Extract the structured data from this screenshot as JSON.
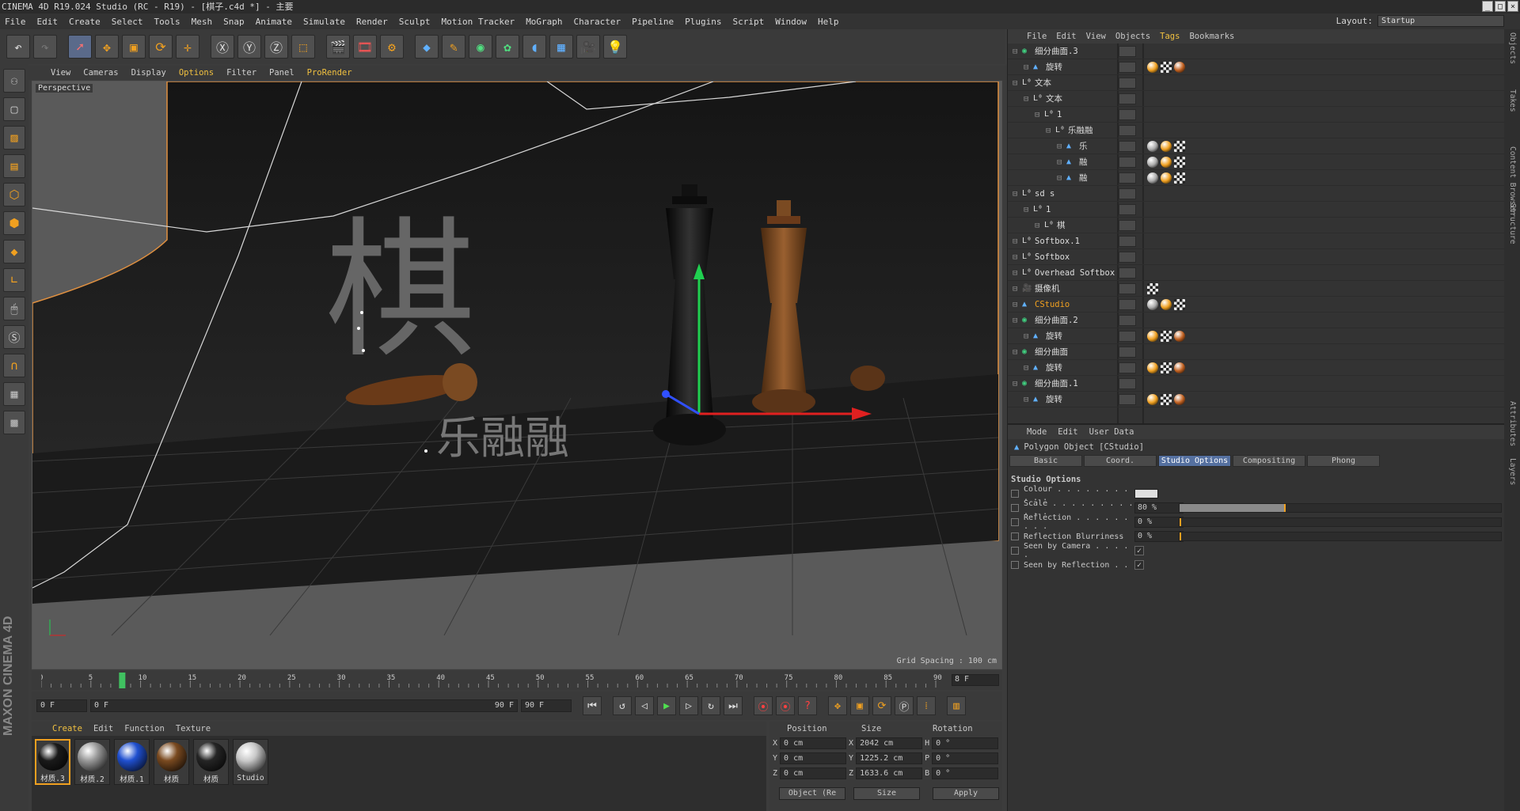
{
  "window": {
    "title": "CINEMA 4D R19.024 Studio (RC - R19) - [棋子.c4d *] - 主要"
  },
  "menubar": {
    "items": [
      "File",
      "Edit",
      "Create",
      "Select",
      "Tools",
      "Mesh",
      "Snap",
      "Animate",
      "Simulate",
      "Render",
      "Sculpt",
      "Motion Tracker",
      "MoGraph",
      "Character",
      "Pipeline",
      "Plugins",
      "Script",
      "Window",
      "Help"
    ],
    "layout_label": "Layout:",
    "layout_value": "Startup"
  },
  "viewport": {
    "menu": [
      "View",
      "Cameras",
      "Display",
      "Options",
      "Filter",
      "Panel",
      "ProRender"
    ],
    "label": "Perspective",
    "grid_spacing": "Grid Spacing : 100 cm",
    "text_big": "棋",
    "text_small": "乐融融"
  },
  "timeline": {
    "ticks": [
      "0",
      "5",
      "10",
      "15",
      "20",
      "25",
      "30",
      "35",
      "40",
      "45",
      "50",
      "55",
      "60",
      "65",
      "70",
      "75",
      "80",
      "85",
      "90"
    ],
    "current_tick": "8",
    "current_frame": "8 F",
    "current_position": 0.089
  },
  "transport": {
    "start": "0 F",
    "range_start": "0 F",
    "range_end": "90 F",
    "end": "90 F"
  },
  "materials": {
    "menu": [
      "Create",
      "Edit",
      "Function",
      "Texture"
    ],
    "items": [
      {
        "name": "材质.3",
        "color": "#1a1a1a"
      },
      {
        "name": "材质.2",
        "color": "#9a9a9a"
      },
      {
        "name": "材质.1",
        "color": "#2050d0"
      },
      {
        "name": "材质",
        "color": "#7a4a20"
      },
      {
        "name": "材质",
        "color": "#252525"
      },
      {
        "name": "Studio",
        "color": "#c8c8c8"
      }
    ]
  },
  "coordinates": {
    "headers": [
      "Position",
      "Size",
      "Rotation"
    ],
    "rows": [
      {
        "axis": "X",
        "pos": "0 cm",
        "size_axis": "X",
        "size": "2042 cm",
        "rot_axis": "H",
        "rot": "0 °"
      },
      {
        "axis": "Y",
        "pos": "0 cm",
        "size_axis": "Y",
        "size": "1225.2 cm",
        "rot_axis": "P",
        "rot": "0 °"
      },
      {
        "axis": "Z",
        "pos": "0 cm",
        "size_axis": "Z",
        "size": "1633.6 cm",
        "rot_axis": "B",
        "rot": "0 °"
      }
    ],
    "mode": "Object (Re",
    "size_mode": "Size",
    "apply": "Apply"
  },
  "objects": {
    "menu": [
      "File",
      "Edit",
      "View",
      "Objects",
      "Tags",
      "Bookmarks"
    ],
    "rows": [
      {
        "name": "细分曲面.3",
        "indent": 0,
        "icon": "subdiv"
      },
      {
        "name": "旋转",
        "indent": 1,
        "icon": "lathe"
      },
      {
        "name": "文本",
        "indent": 0,
        "icon": "null"
      },
      {
        "name": "文本",
        "indent": 1,
        "icon": "null"
      },
      {
        "name": "1",
        "indent": 2,
        "icon": "null"
      },
      {
        "name": "乐融融",
        "indent": 3,
        "icon": "null"
      },
      {
        "name": "乐",
        "indent": 4,
        "icon": "poly"
      },
      {
        "name": "融",
        "indent": 4,
        "icon": "poly"
      },
      {
        "name": "融",
        "indent": 4,
        "icon": "poly"
      },
      {
        "name": "sd s",
        "indent": 0,
        "icon": "null"
      },
      {
        "name": "1",
        "indent": 1,
        "icon": "null"
      },
      {
        "name": "棋",
        "indent": 2,
        "icon": "null"
      },
      {
        "name": "Softbox.1",
        "indent": 0,
        "icon": "null"
      },
      {
        "name": "Softbox",
        "indent": 0,
        "icon": "null"
      },
      {
        "name": "Overhead Softbox",
        "indent": 0,
        "icon": "null"
      },
      {
        "name": "摄像机",
        "indent": 0,
        "icon": "camera"
      },
      {
        "name": "CStudio",
        "indent": 0,
        "icon": "poly",
        "selected": true
      },
      {
        "name": "细分曲面.2",
        "indent": 0,
        "icon": "subdiv"
      },
      {
        "name": "旋转",
        "indent": 1,
        "icon": "lathe"
      },
      {
        "name": "细分曲面",
        "indent": 0,
        "icon": "subdiv"
      },
      {
        "name": "旋转",
        "indent": 1,
        "icon": "lathe"
      },
      {
        "name": "细分曲面.1",
        "indent": 0,
        "icon": "subdiv"
      },
      {
        "name": "旋转",
        "indent": 1,
        "icon": "lathe"
      }
    ]
  },
  "attributes": {
    "menu": [
      "Mode",
      "Edit",
      "User Data"
    ],
    "title": "Polygon Object [CStudio]",
    "tabs": [
      "Basic",
      "Coord.",
      "Studio Options",
      "Compositing",
      "Phong"
    ],
    "active_tab": "Studio Options",
    "section": "Studio Options",
    "rows": [
      {
        "label": "Colour . . . . . . . . . . .",
        "type": "color",
        "value": ""
      },
      {
        "label": "Scale . . . . . . . . . . . .",
        "type": "slider",
        "value": "80 %",
        "fill": 0.33
      },
      {
        "label": "Reflection . . . . . . . . .",
        "type": "slider",
        "value": "0 %",
        "fill": 0
      },
      {
        "label": "Reflection Blurriness",
        "type": "slider",
        "value": "0 %",
        "fill": 0
      },
      {
        "label": "Seen by Camera . . . . .",
        "type": "check",
        "value": "✓"
      },
      {
        "label": "Seen by Reflection . .",
        "type": "check",
        "value": "✓"
      }
    ]
  },
  "side_tabs": [
    "Objects",
    "Takes",
    "Content Browser",
    "Structure",
    "Attributes",
    "Layers"
  ]
}
